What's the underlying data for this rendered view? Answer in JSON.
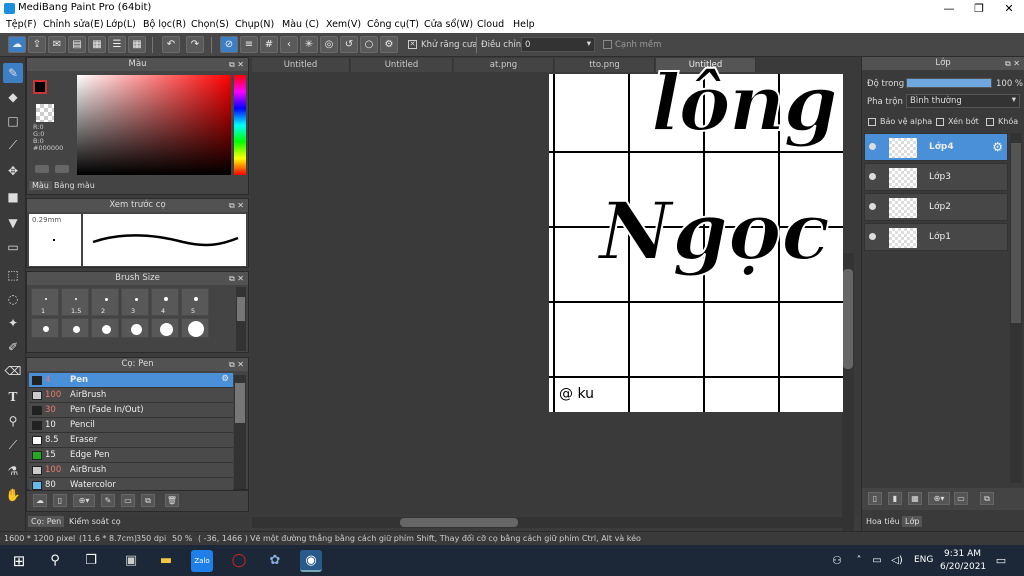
{
  "window": {
    "title": "MediBang Paint Pro (64bit)",
    "minimize": "—",
    "maximize": "❐",
    "close": "✕"
  },
  "menu": [
    "Tệp(F)",
    "Chỉnh sửa(E)",
    "Lớp(L)",
    "Bộ lọc(R)",
    "Chọn(S)",
    "Chụp(N)",
    "Màu (C)",
    "Xem(V)",
    "Công cụ(T)",
    "Cửa sổ(W)",
    "Cloud",
    "Help"
  ],
  "toolbar": {
    "antialias_label": "Khử răng cưa",
    "adjust_label": "Điều chỉnh",
    "adjust_value": "0",
    "snap_label": "Cạnh mềm"
  },
  "color_panel": {
    "title": "Màu",
    "r": "R:0",
    "g": "G:0",
    "b": "B:0",
    "hex": "#000000",
    "tab_color": "Màu",
    "tab_palette": "Bảng màu",
    "main_color": "#000000"
  },
  "brush_preview": {
    "title": "Xem trước cọ",
    "size": "0.29mm"
  },
  "brush_size": {
    "title": "Brush Size",
    "sizes": [
      "1",
      "1.5",
      "2",
      "3",
      "4",
      "5"
    ]
  },
  "brush_list": {
    "title": "Cọ: Pen",
    "items": [
      {
        "size": "4",
        "name": "Pen",
        "color": "#222222",
        "selected": true
      },
      {
        "size": "100",
        "name": "AirBrush",
        "color": "#cccccc",
        "selected": false
      },
      {
        "size": "30",
        "name": "Pen (Fade In/Out)",
        "color": "#222222",
        "selected": false
      },
      {
        "size": "10",
        "name": "Pencil",
        "color": "#222222",
        "selected": false
      },
      {
        "size": "8.5",
        "name": "Eraser",
        "color": "#ffffff",
        "selected": false
      },
      {
        "size": "15",
        "name": "Edge Pen",
        "color": "#22aa22",
        "selected": false
      },
      {
        "size": "100",
        "name": "AirBrush",
        "color": "#cccccc",
        "selected": false
      },
      {
        "size": "80",
        "name": "Watercolor",
        "color": "#66bbee",
        "selected": false
      }
    ]
  },
  "bottom_tabs": {
    "brush": "Cọ: Pen",
    "control": "Kiểm soát cọ"
  },
  "tabs": [
    "Untitled",
    "Untitled",
    "at.png",
    "tto.png",
    "Untitled"
  ],
  "canvas_text": {
    "line1": "lông",
    "line2": "Ngọc",
    "signature": "@ ku"
  },
  "layers_panel": {
    "title": "Lớp",
    "opacity_label": "Độ trong",
    "opacity_value": "100 %",
    "opacity": 1.0,
    "blend_label": "Pha trộn",
    "blend_value": "Bình thường",
    "protect_alpha": "Bảo vệ alpha",
    "clip": "Xén bớt",
    "lock": "Khóa",
    "layers": [
      {
        "name": "Lớp4",
        "selected": true
      },
      {
        "name": "Lớp3",
        "selected": false
      },
      {
        "name": "Lớp2",
        "selected": false
      },
      {
        "name": "Lớp1",
        "selected": false
      }
    ],
    "tab_navigator": "Hoa tiêu",
    "tab_layer": "Lớp"
  },
  "status": {
    "size": "1600 * 1200 pixel",
    "physical": "(11.6 * 8.7cm)",
    "dpi": "350 dpi",
    "zoom": "50 %",
    "coords": "( -36, 1466 )",
    "hint": "Vẽ một đường thẳng bằng cách giữ phím Shift, Thay đổi cỡ cọ bằng cách giữ phím Ctrl, Alt và kéo"
  },
  "taskbar": {
    "time": "9:31 AM",
    "date": "6/20/2021",
    "lang": "ENG"
  }
}
